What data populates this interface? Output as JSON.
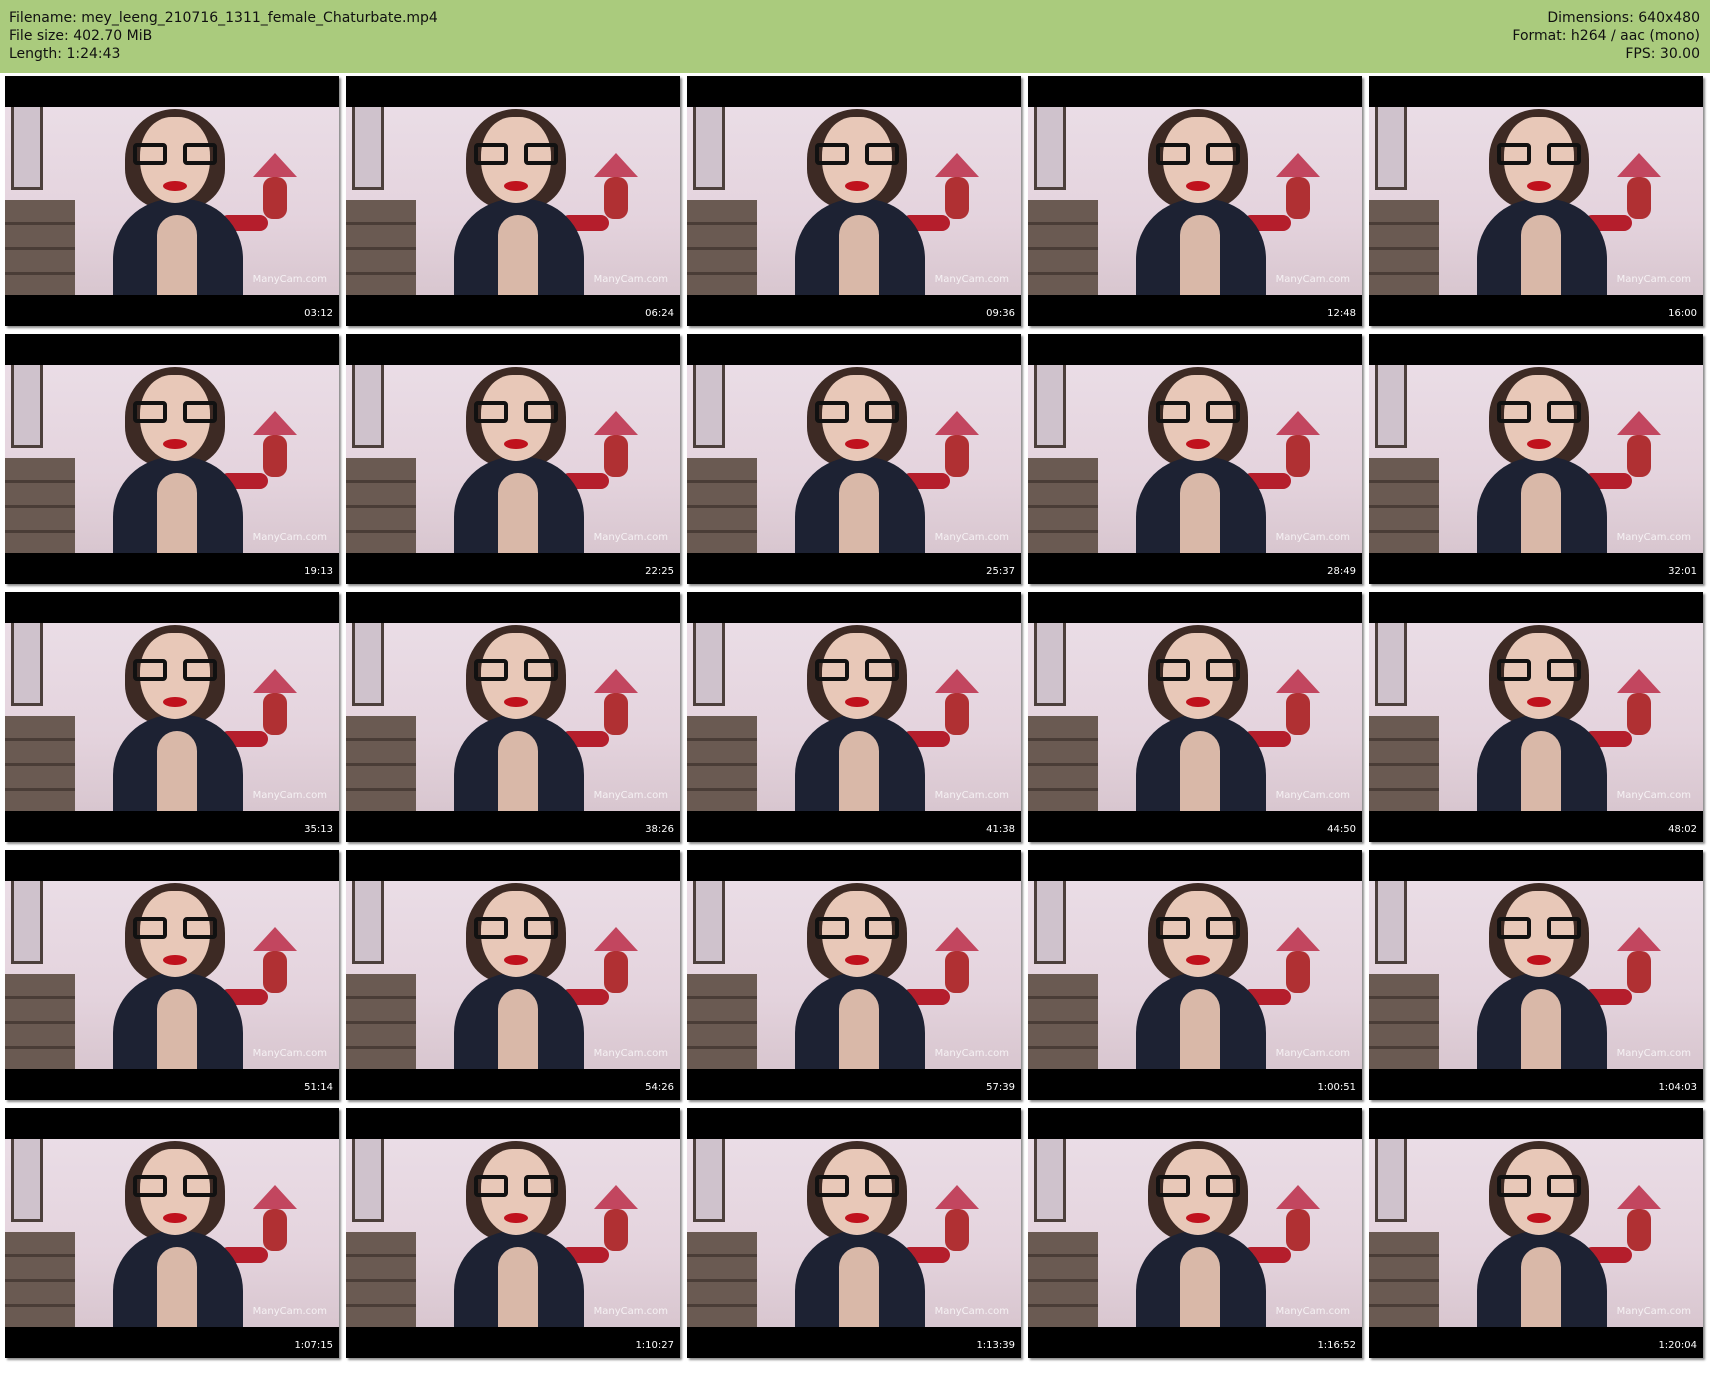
{
  "header": {
    "filename": "Filename: mey_leeng_210716_1311_female_Chaturbate.mp4",
    "filesize": "File size: 402.70 MiB",
    "length": "Length: 1:24:43",
    "dimensions": "Dimensions: 640x480",
    "format": "Format: h264 / aac (mono)",
    "fps": "FPS: 30.00"
  },
  "colors": {
    "header_bg": "#aacb7d",
    "frame_bg": "#000000"
  },
  "thumbnails": [
    {
      "timestamp": "03:12",
      "watermark": "ManyCam.com"
    },
    {
      "timestamp": "06:24",
      "watermark": "ManyCam.com"
    },
    {
      "timestamp": "09:36",
      "watermark": "ManyCam.com"
    },
    {
      "timestamp": "12:48",
      "watermark": "ManyCam.com"
    },
    {
      "timestamp": "16:00",
      "watermark": "ManyCam.com"
    },
    {
      "timestamp": "19:13",
      "watermark": "ManyCam.com"
    },
    {
      "timestamp": "22:25",
      "watermark": "ManyCam.com"
    },
    {
      "timestamp": "25:37",
      "watermark": "ManyCam.com"
    },
    {
      "timestamp": "28:49",
      "watermark": "ManyCam.com"
    },
    {
      "timestamp": "32:01",
      "watermark": "ManyCam.com"
    },
    {
      "timestamp": "35:13",
      "watermark": "ManyCam.com"
    },
    {
      "timestamp": "38:26",
      "watermark": "ManyCam.com"
    },
    {
      "timestamp": "41:38",
      "watermark": "ManyCam.com"
    },
    {
      "timestamp": "44:50",
      "watermark": "ManyCam.com"
    },
    {
      "timestamp": "48:02",
      "watermark": "ManyCam.com"
    },
    {
      "timestamp": "51:14",
      "watermark": "ManyCam.com"
    },
    {
      "timestamp": "54:26",
      "watermark": "ManyCam.com"
    },
    {
      "timestamp": "57:39",
      "watermark": "ManyCam.com"
    },
    {
      "timestamp": "1:00:51",
      "watermark": "ManyCam.com"
    },
    {
      "timestamp": "1:04:03",
      "watermark": "ManyCam.com"
    },
    {
      "timestamp": "1:07:15",
      "watermark": "ManyCam.com"
    },
    {
      "timestamp": "1:10:27",
      "watermark": "ManyCam.com"
    },
    {
      "timestamp": "1:13:39",
      "watermark": "ManyCam.com"
    },
    {
      "timestamp": "1:16:52",
      "watermark": "ManyCam.com"
    },
    {
      "timestamp": "1:20:04",
      "watermark": "ManyCam.com"
    }
  ]
}
